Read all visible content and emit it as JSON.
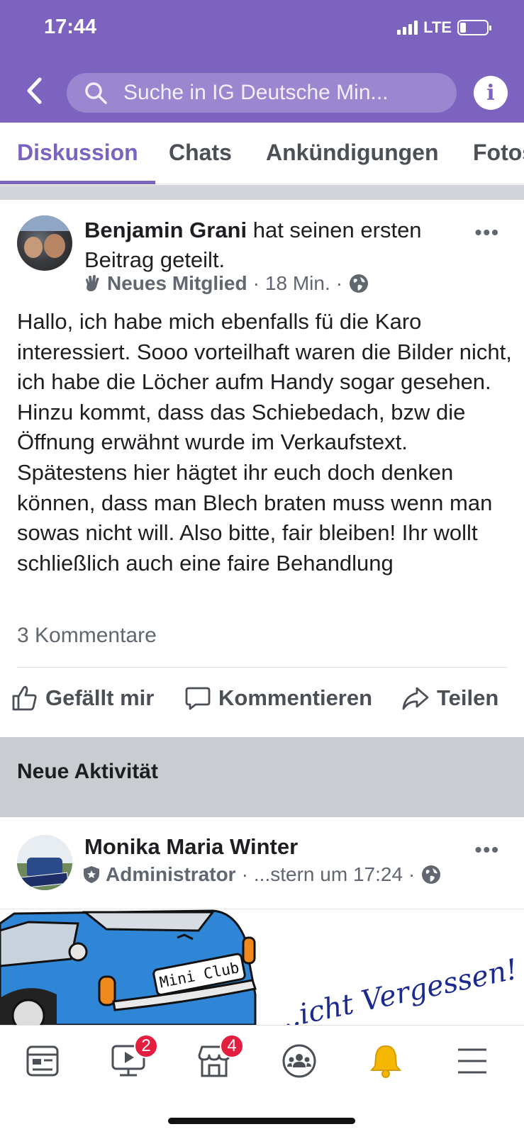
{
  "status_bar": {
    "time": "17:44",
    "network": "LTE"
  },
  "header": {
    "search_placeholder": "Suche in IG Deutsche Min...",
    "info_glyph": "i"
  },
  "tabs": [
    {
      "label": "Diskussion",
      "active": true
    },
    {
      "label": "Chats",
      "active": false
    },
    {
      "label": "Ankündigungen",
      "active": false
    },
    {
      "label": "Fotos",
      "active": false
    }
  ],
  "post": {
    "author": "Benjamin Grani",
    "action_text": " hat seinen ersten Beitrag geteilt.",
    "badge": "Neues Mitglied",
    "time": "18 Min.",
    "body": "Hallo, ich habe mich ebenfalls fü die Karo interessiert. Sooo vorteilhaft waren die Bilder nicht, ich habe die Löcher aufm Handy sogar gesehen. Hinzu kommt, dass das Schiebedach, bzw die Öffnung erwähnt wurde im Verkaufstext. Spätestens hier hägtet ihr euch doch denken können, dass man Blech braten muss wenn man sowas nicht will. Also bitte, fair bleiben! Ihr wollt schließlich auch eine faire Behandlung",
    "comments_count": "3 Kommentare",
    "actions": {
      "like": "Gefällt mir",
      "comment": "Kommentieren",
      "share": "Teilen"
    }
  },
  "new_activity": {
    "section_title": "Neue Aktivität",
    "author": "Monika Maria Winter",
    "role": "Administrator",
    "time": "...stern um 17:24"
  },
  "preview_image": {
    "plate_text": "Mini Club",
    "caption_text": "...icht Vergessen!"
  },
  "bottom_nav": {
    "video_badge": "2",
    "marketplace_badge": "4"
  },
  "colors": {
    "brand": "#7b63bf",
    "badge": "#e41e3f"
  }
}
